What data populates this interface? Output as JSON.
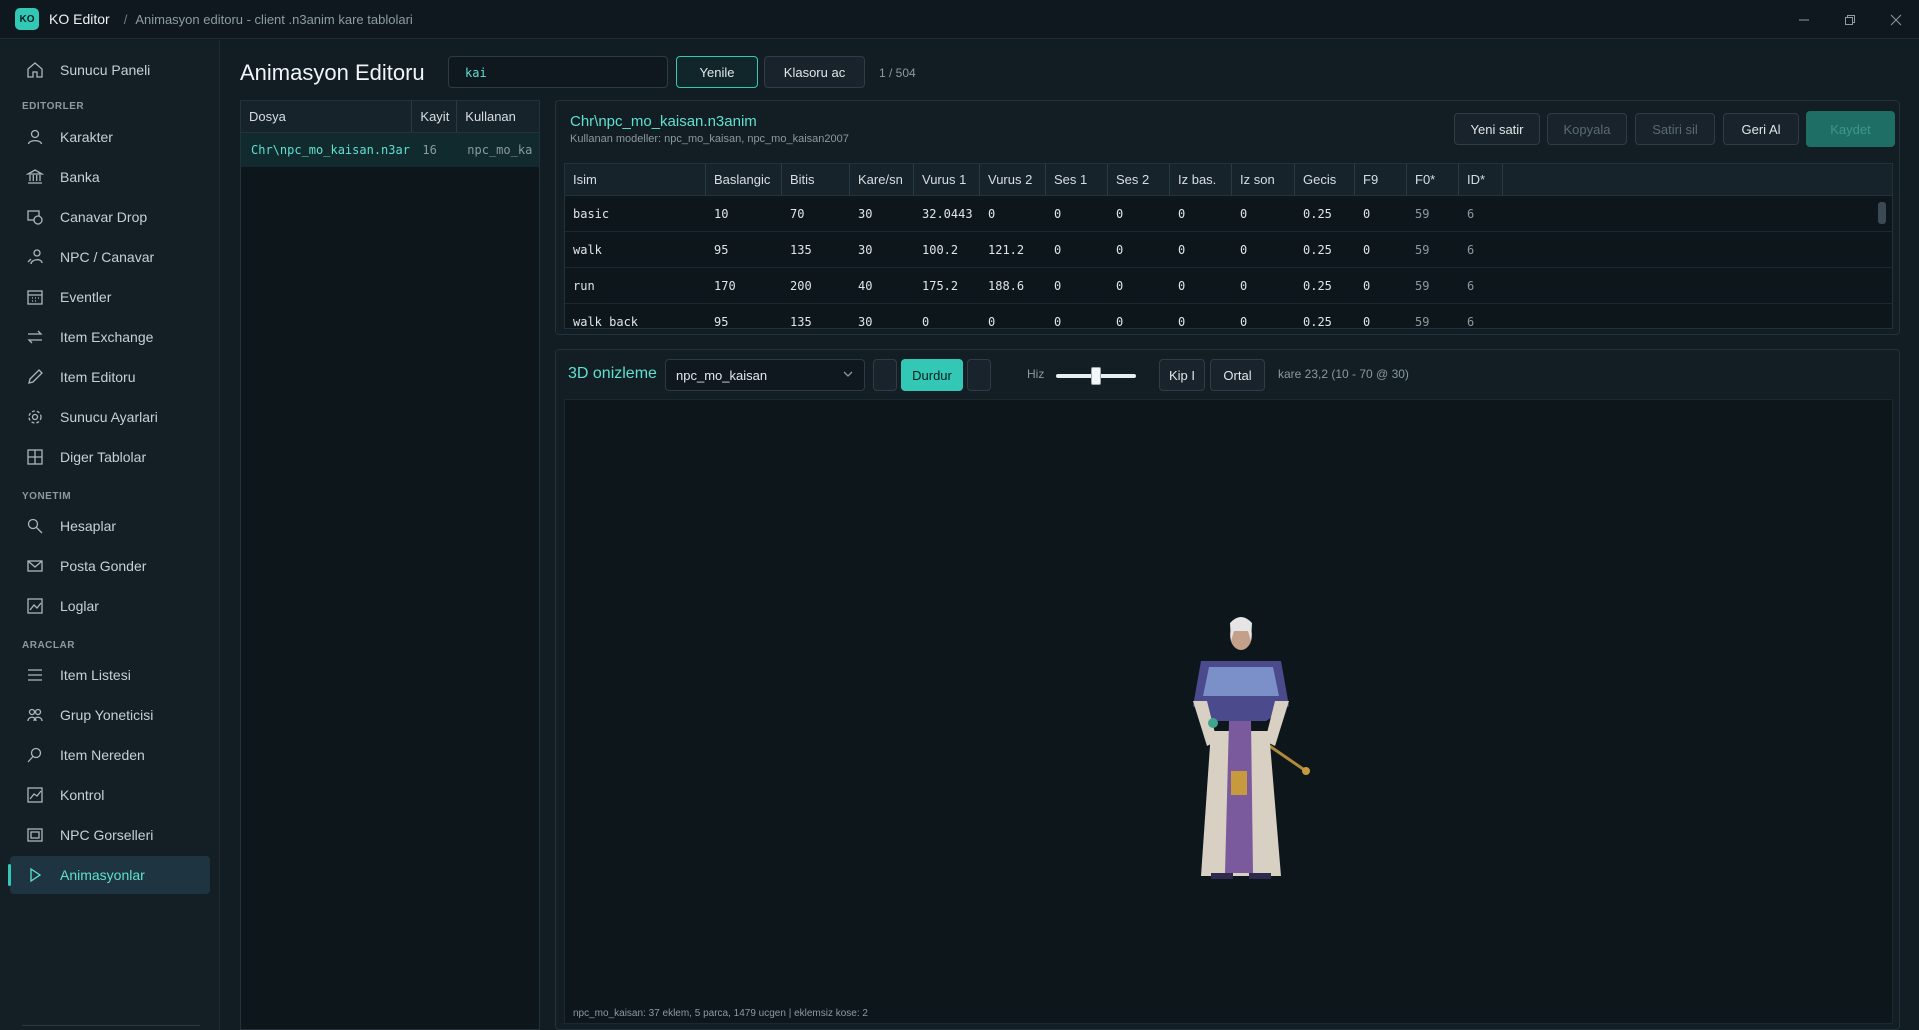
{
  "titlebar": {
    "logo": "KO",
    "app_name": "KO Editor",
    "separator": "/",
    "breadcrumb": "Animasyon editoru - client .n3anim kare tablolari"
  },
  "sidebar": {
    "top_item": {
      "label": "Sunucu Paneli",
      "icon": "home-icon"
    },
    "sections": [
      {
        "title": "EDITORLER"
      },
      {
        "title": "YONETIM"
      },
      {
        "title": "ARACLAR"
      }
    ],
    "items": [
      {
        "label": "Karakter",
        "icon": "user-icon"
      },
      {
        "label": "Banka",
        "icon": "bank-icon"
      },
      {
        "label": "Canavar Drop",
        "icon": "drop-icon"
      },
      {
        "label": "NPC / Canavar",
        "icon": "npc-icon"
      },
      {
        "label": "Eventler",
        "icon": "calendar-icon"
      },
      {
        "label": "Item Exchange",
        "icon": "exchange-icon"
      },
      {
        "label": "Item Editoru",
        "icon": "pencil-icon"
      },
      {
        "label": "Sunucu Ayarlari",
        "icon": "gear-icon"
      },
      {
        "label": "Diger Tablolar",
        "icon": "grid-icon"
      },
      {
        "label": "Hesaplar",
        "icon": "user-search-icon"
      },
      {
        "label": "Posta Gonder",
        "icon": "mail-icon"
      },
      {
        "label": "Loglar",
        "icon": "log-icon"
      },
      {
        "label": "Item Listesi",
        "icon": "list-icon"
      },
      {
        "label": "Grup Yoneticisi",
        "icon": "group-icon"
      },
      {
        "label": "Item Nereden",
        "icon": "search-icon"
      },
      {
        "label": "Kontrol",
        "icon": "check-chart-icon"
      },
      {
        "label": "NPC Gorselleri",
        "icon": "image-icon"
      },
      {
        "label": "Animasyonlar",
        "icon": "play-icon",
        "active": true
      }
    ]
  },
  "main": {
    "title": "Animasyon Editoru",
    "search_value": "kai",
    "refresh_label": "Yenile",
    "open_folder_label": "Klasoru ac",
    "count": "1 / 504"
  },
  "filelist": {
    "columns": [
      "Dosya",
      "Kayit",
      "Kullanan"
    ],
    "rows": [
      {
        "file": "Chr\\npc_mo_kaisan.n3ar",
        "count": "16",
        "user": "npc_mo_ka"
      }
    ]
  },
  "anim": {
    "title": "Chr\\npc_mo_kaisan.n3anim",
    "subtitle": "Kullanan modeller: npc_mo_kaisan, npc_mo_kaisan2007",
    "buttons": {
      "new_row": "Yeni satir",
      "copy": "Kopyala",
      "delete_row": "Satiri sil",
      "undo": "Geri Al",
      "save": "Kaydet"
    },
    "columns": [
      "Isim",
      "Baslangic",
      "Bitis",
      "Kare/sn",
      "Vurus 1",
      "Vurus 2",
      "Ses 1",
      "Ses 2",
      "Iz bas.",
      "Iz son",
      "Gecis",
      "F9",
      "F0*",
      "ID*"
    ],
    "rows": [
      [
        "basic",
        "10",
        "70",
        "30",
        "32.0443",
        "0",
        "0",
        "0",
        "0",
        "0",
        "0.25",
        "0",
        "59",
        "6"
      ],
      [
        "walk",
        "95",
        "135",
        "30",
        "100.2",
        "121.2",
        "0",
        "0",
        "0",
        "0",
        "0.25",
        "0",
        "59",
        "6"
      ],
      [
        "run",
        "170",
        "200",
        "40",
        "175.2",
        "188.6",
        "0",
        "0",
        "0",
        "0",
        "0.25",
        "0",
        "59",
        "6"
      ],
      [
        "walk_back",
        "95",
        "135",
        "30",
        "0",
        "0",
        "0",
        "0",
        "0",
        "0",
        "0.25",
        "0",
        "59",
        "6"
      ]
    ]
  },
  "preview": {
    "title": "3D onizleme",
    "model": "npc_mo_kaisan",
    "stop_label": "Durdur",
    "speed_label": "Hiz",
    "speed_value": 0.5,
    "mode_label": "Kip I",
    "center_label": "Ortal",
    "frame_info": "kare 23,2   (10 - 70 @ 30)",
    "status": "npc_mo_kaisan: 37 eklem, 5 parca, 1479 ucgen | eklemsiz kose: 2"
  },
  "colors": {
    "accent": "#33c8b6",
    "accent_text": "#5fe0d0",
    "background": "#121c23"
  }
}
